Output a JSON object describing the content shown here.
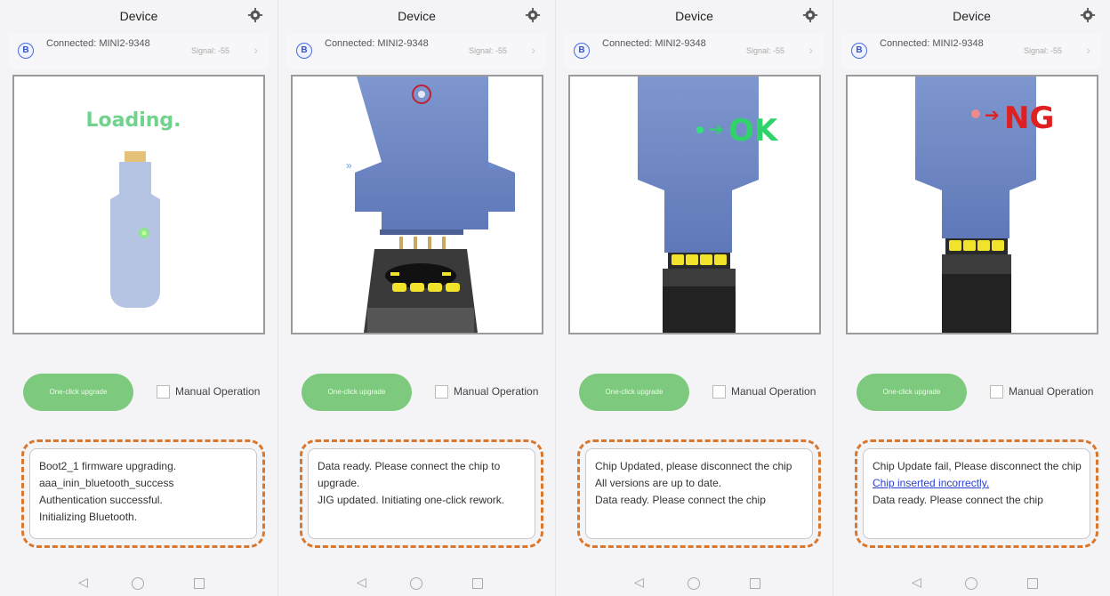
{
  "screens": [
    {
      "title": "Device",
      "bt_icon_label": "B",
      "connected_label": "Connected: MINI2-9348",
      "signal_label": "Signal: -55",
      "status_overlay": "Loading.",
      "status_color": "#6fd38d",
      "upgrade_button_label": "One-click upgrade",
      "manual_operation_label": "Manual Operation",
      "log_lines": [
        {
          "text": "Boot2_1 firmware upgrading."
        },
        {
          "text": "aaa_inin_bluetooth_success"
        },
        {
          "text": "Authentication successful."
        },
        {
          "text": "Initializing Bluetooth."
        }
      ]
    },
    {
      "title": "Device",
      "bt_icon_label": "B",
      "connected_label": "Connected: MINI2-9348",
      "signal_label": "Signal: -55",
      "status_overlay": "",
      "upgrade_button_label": "One-click upgrade",
      "manual_operation_label": "Manual Operation",
      "log_lines": [
        {
          "text": "Data ready. Please connect the chip to upgrade."
        },
        {
          "text": "JIG updated. Initiating one-click rework."
        }
      ]
    },
    {
      "title": "Device",
      "bt_icon_label": "B",
      "connected_label": "Connected: MINI2-9348",
      "signal_label": "Signal: -55",
      "status_overlay": "OK",
      "status_color": "#2fd36a",
      "upgrade_button_label": "One-click upgrade",
      "manual_operation_label": "Manual Operation",
      "log_lines": [
        {
          "text": "Chip Updated, please disconnect the chip"
        },
        {
          "text": "All versions are up to date."
        },
        {
          "text": "Data ready. Please connect the chip"
        }
      ]
    },
    {
      "title": "Device",
      "bt_icon_label": "B",
      "connected_label": "Connected: MINI2-9348",
      "signal_label": "Signal: -55",
      "status_overlay": "NG",
      "status_color": "#e02020",
      "upgrade_button_label": "One-click upgrade",
      "manual_operation_label": "Manual Operation",
      "log_lines": [
        {
          "text": "Chip Update fail, Please disconnect the chip"
        },
        {
          "text": "Chip inserted incorrectly.",
          "link": true
        },
        {
          "text": "Data ready. Please connect the chip"
        }
      ]
    }
  ],
  "colors": {
    "accent_green": "#7dc97d",
    "highlight_orange": "#d9772e",
    "link_blue": "#2a3fd1",
    "device_blue": "#6c86c4"
  },
  "icons": {
    "settings": "gear-icon",
    "bluetooth": "bluetooth-icon",
    "chevron": "chevron-right-icon",
    "nav_back": "back-triangle-icon",
    "nav_home": "home-circle-icon",
    "nav_recent": "recent-square-icon"
  }
}
